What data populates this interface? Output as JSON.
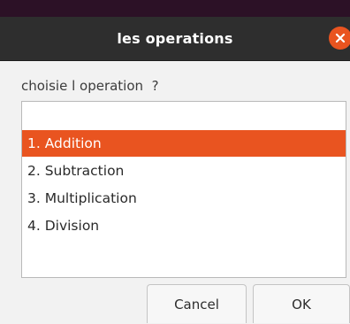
{
  "dialog": {
    "title": "les operations",
    "prompt": "choisie l operation  ?"
  },
  "list": {
    "items": [
      {
        "label": "1. Addition",
        "selected": true
      },
      {
        "label": "2. Subtraction",
        "selected": false
      },
      {
        "label": "3. Multiplication",
        "selected": false
      },
      {
        "label": "4. Division",
        "selected": false
      }
    ]
  },
  "buttons": {
    "cancel_label": "Cancel",
    "ok_label": "OK"
  },
  "icons": {
    "close": "close-icon"
  },
  "colors": {
    "accent": "#e95420",
    "titlebar": "#2e2e2e",
    "background": "#f2f2f2"
  }
}
